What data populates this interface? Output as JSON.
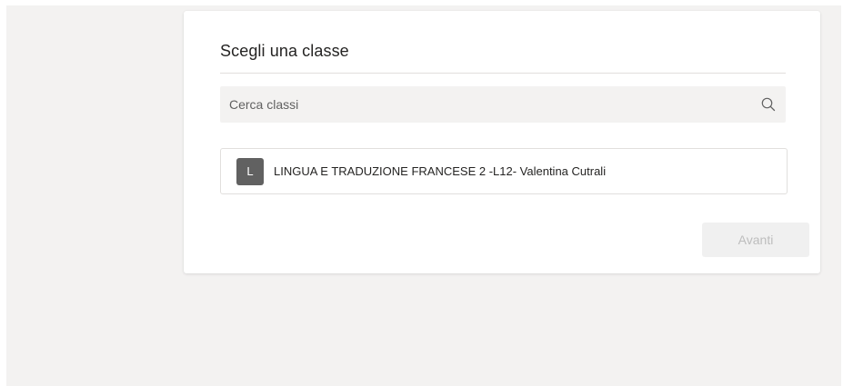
{
  "dialog": {
    "title": "Scegli una classe",
    "search": {
      "placeholder": "Cerca classi",
      "value": "",
      "icon": "search-icon"
    },
    "classes": [
      {
        "avatar_letter": "L",
        "name": "LINGUA E TRADUZIONE FRANCESE 2 -L12- Valentina Cutrali"
      }
    ],
    "next_button": {
      "label": "Avanti",
      "enabled": false
    }
  },
  "colors": {
    "background": "#f3f2f1",
    "card": "#ffffff",
    "avatar": "#616161",
    "button_disabled_bg": "#f0f0f0",
    "button_disabled_text": "#bdbdbd"
  }
}
